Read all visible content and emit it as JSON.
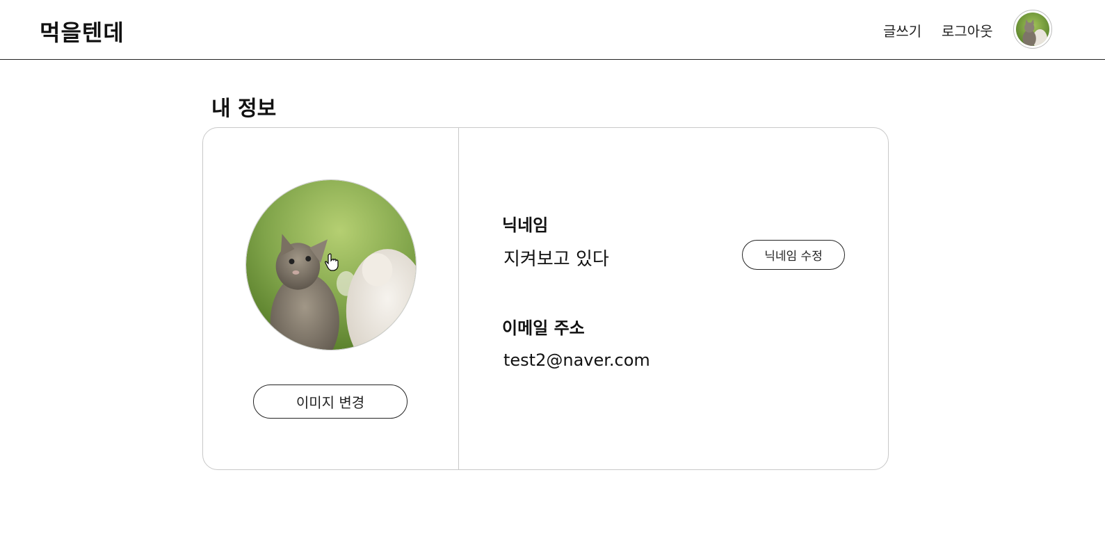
{
  "header": {
    "logo": "먹을텐데",
    "nav": {
      "write": "글쓰기",
      "logout": "로그아웃"
    },
    "avatar_icon": "user-avatar-cat"
  },
  "page": {
    "title": "내 정보"
  },
  "profile": {
    "photo_icon": "cat-photo",
    "change_image_label": "이미지 변경"
  },
  "info": {
    "nickname_label": "닉네임",
    "nickname_value": "지켜보고 있다",
    "edit_nickname_label": "닉네임 수정",
    "email_label": "이메일 주소",
    "email_value": "test2@naver.com"
  },
  "colors": {
    "border": "#c8c8c8",
    "text": "#111111",
    "button_border": "#222222"
  }
}
